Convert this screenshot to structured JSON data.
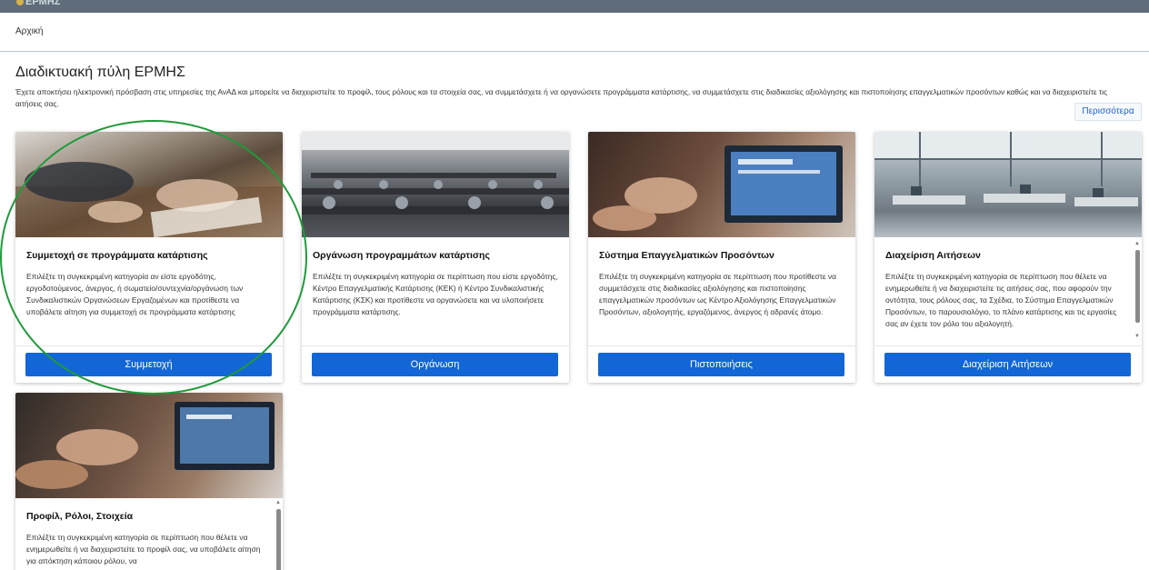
{
  "header": {
    "logo_text": "ΕΡΜΗΣ"
  },
  "breadcrumb": "Αρχική",
  "page": {
    "title": "Διαδικτυακή πύλη ΕΡΜΗΣ",
    "description": "Έχετε αποκτήσει ηλεκτρονική πρόσβαση στις υπηρεσίες της ΑνΑΔ και μπορείτε να διαχειριστείτε το προφίλ, τους ρόλους και τα στοιχεία σας, να συμμετάσχετε ή να οργανώσετε προγράμματα κατάρτισης, να συμμετάσχετε στις διαδικασίες αξιολόγησης και πιστοποίησης επαγγελματικών προσόντων καθώς και να διαχειριστείτε τις αιτήσεις σας.",
    "more_label": "Περισσότερα"
  },
  "cards": [
    {
      "title": "Συμμετοχή σε προγράμματα κατάρτισης",
      "text": "Επιλέξτε τη συγκεκριμένη κατηγορία αν είστε εργοδότης, εργοδοτούμενος, άνεργος, ή σωματείο/συντεχνία/οργάνωση των Συνδικαλιστικών Οργανώσεων Εργαζομένων και προτίθεστε να υποβάλετε αίτηση για συμμετοχή σε προγράμματα κατάρτισης",
      "button": "Συμμετοχή"
    },
    {
      "title": "Οργάνωση προγραμμάτων κατάρτισης",
      "text": "Επιλέξτε τη συγκεκριμένη κατηγορία σε περίπτωση που είστε εργοδότης, Κέντρο Επαγγελματικής Κατάρτισης (ΚΕΚ) ή Κέντρο Συνδικαλιστικής Κατάρτισης (ΚΣΚ) και προτίθεστε να οργανώσετε και να υλοποιήσετε προγράμματα κατάρτισης.",
      "button": "Οργάνωση"
    },
    {
      "title": "Σύστημα Επαγγελματικών Προσόντων",
      "text": "Επιλέξτε τη συγκεκριμένη κατηγορία σε περίπτωση που προτίθεστε να συμμετάσχετε στις διαδικασίες αξιολόγησης και πιστοποίησης επαγγελματικών προσόντων ως Κέντρο Αξιολόγησης Επαγγελματικών Προσόντων, αξιολογητής, εργαζόμενος, άνεργος ή αδρανές άτομο.",
      "button": "Πιστοποιήσεις"
    },
    {
      "title": "Διαχείριση Αιτήσεων",
      "text": "Επιλέξτε τη συγκεκριμένη κατηγορία σε περίπτωση που θέλετε να ενημερωθείτε ή να διαχειριστείτε τις αιτήσεις σας, που αφορούν την οντότητα, τους ρόλους σας, τα Σχέδια, το Σύστημα Επαγγελματικών Προσόντων, το παρουσιολόγιο, το πλάνο κατάρτισης και τις εργασίες σας αν έχετε τον ρόλο του αξιολογητή.",
      "button": "Διαχείριση Αιτήσεων"
    },
    {
      "title": "Προφίλ, Ρόλοι, Στοιχεία",
      "text": "Επιλέξτε τη συγκεκριμένη κατηγορία σε περίπτωση που θέλετε να ενημερωθείτε ή να διαχειριστείτε το προφίλ σας, να υποβάλετε αίτηση για απόκτηση κάποιου ρόλου, να"
    }
  ],
  "colors": {
    "primary": "#1266d6",
    "highlight_circle": "#1f9a3a",
    "topbar": "#5f6d7a"
  }
}
